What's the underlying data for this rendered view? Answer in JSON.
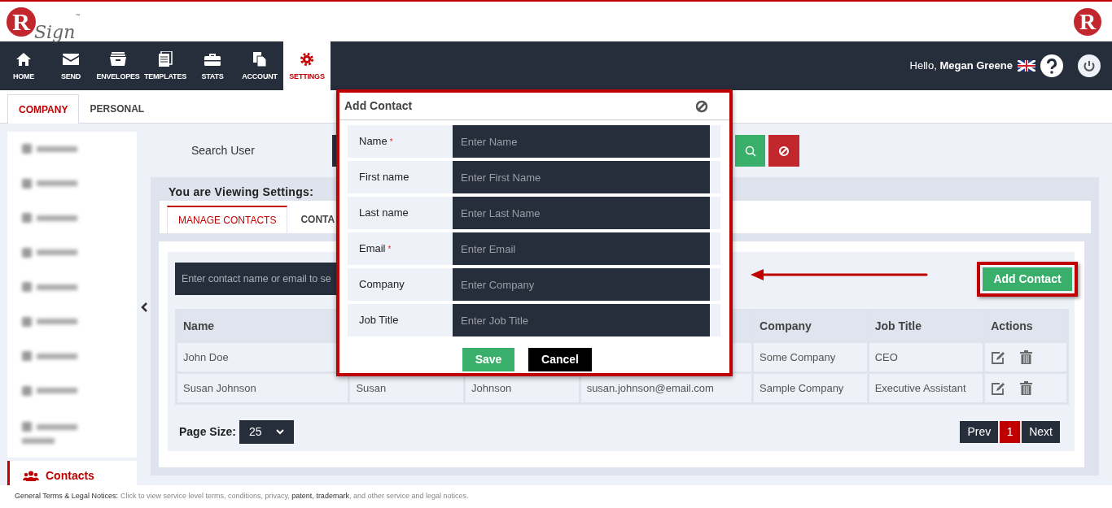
{
  "header": {
    "logo": {
      "mark": "R",
      "text": "Sign",
      "tm": "™"
    },
    "corner_logo": "R"
  },
  "nav": [
    {
      "label": "HOME",
      "selected": false
    },
    {
      "label": "SEND",
      "selected": false
    },
    {
      "label": "ENVELOPES",
      "selected": false
    },
    {
      "label": "TEMPLATES",
      "selected": false
    },
    {
      "label": "STATS",
      "selected": false
    },
    {
      "label": "ACCOUNT",
      "selected": false
    },
    {
      "label": "SETTINGS",
      "selected": true
    }
  ],
  "greeting": "Hello, **Megan Greene**",
  "settings_tabs": [
    {
      "label": "COMPANY",
      "selected": true
    },
    {
      "label": "PERSONAL",
      "selected": false
    }
  ],
  "sidebar": {
    "items": [
      {
        "kind": "blurred"
      },
      {
        "kind": "blurred"
      },
      {
        "kind": "blurred"
      },
      {
        "kind": "blurred"
      },
      {
        "kind": "blurred"
      },
      {
        "kind": "blurred"
      },
      {
        "kind": "blurred"
      },
      {
        "kind": "blurred"
      },
      {
        "kind": "blurred_tall"
      },
      {
        "kind": "link",
        "label": "Contacts",
        "selected": true
      }
    ]
  },
  "search_user": {
    "label": "Search User"
  },
  "viewing_title": "You are Viewing Settings:",
  "content_tabs": [
    {
      "label": "MANAGE CONTACTS",
      "selected": true
    },
    {
      "label": "CONTA",
      "selected": false
    }
  ],
  "contact_search": {
    "placeholder": "Enter contact name or email to se"
  },
  "add_contact_button": "Add Contact",
  "table": {
    "columns": [
      "Name",
      "Company",
      "Job Title",
      "Actions"
    ],
    "rows": [
      {
        "name": "John Doe",
        "company": "Some Company",
        "job_title": "CEO"
      },
      {
        "name": "Susan Johnson",
        "first_name": "Susan",
        "last_name": "Johnson",
        "email": "susan.johnson@email.com",
        "company": "Sample Company",
        "job_title": "Executive Assistant"
      }
    ]
  },
  "page_size": {
    "label": "Page Size:",
    "value": "25"
  },
  "pagination": {
    "prev": "Prev",
    "pages": [
      {
        "label": "1",
        "selected": true
      }
    ],
    "next": "Next"
  },
  "modal": {
    "title": "Add Contact",
    "fields": [
      {
        "label": "Name",
        "marker": "*",
        "placeholder": "Enter Name"
      },
      {
        "label": "First name",
        "placeholder": "Enter First Name"
      },
      {
        "label": "Last name",
        "placeholder": "Enter Last Name"
      },
      {
        "label": "Email",
        "marker": "*",
        "placeholder": "Enter Email"
      },
      {
        "label": "Company",
        "placeholder": "Enter Company"
      },
      {
        "label": "Job Title",
        "placeholder": "Enter Job Title"
      }
    ],
    "buttons": [
      "Save",
      "Cancel"
    ]
  },
  "footer": {
    "title": "General Terms & Legal Notices:",
    "text_start": "Click to view service level terms, conditions, privacy,",
    "links": [
      "patent",
      "trademark"
    ],
    "link_separator": ",",
    "text_end": ", and other service and legal notices."
  }
}
